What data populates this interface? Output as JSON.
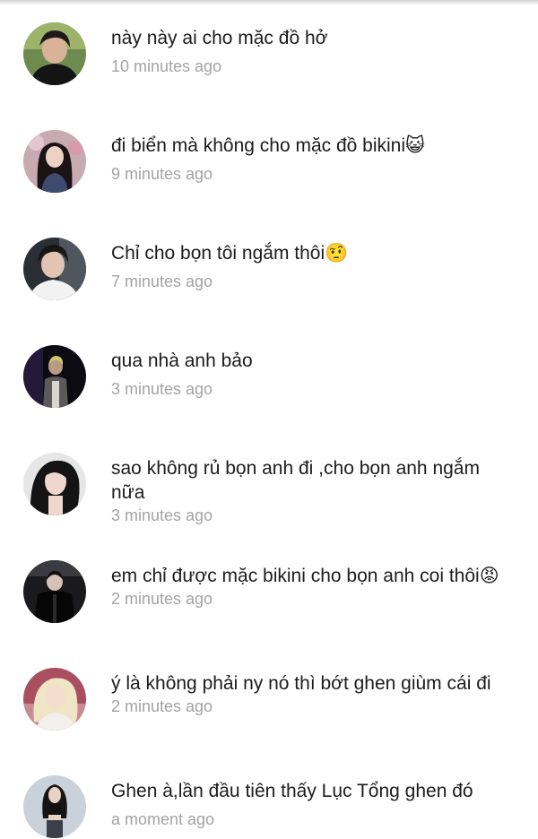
{
  "comments": [
    {
      "text": "này này ai cho mặc đồ hở",
      "time": "10 minutes ago",
      "avatar": "avatar-man-dark-hair"
    },
    {
      "text": "đi biển mà không cho mặc đồ bikini😺",
      "time": "9 minutes ago",
      "avatar": "avatar-woman-long-hair"
    },
    {
      "text": "Chỉ cho bọn tôi ngắm thôi🤨",
      "time": "7 minutes ago",
      "avatar": "avatar-man-white-shirt"
    },
    {
      "text": "qua nhà anh bảo",
      "time": "3 minutes ago",
      "avatar": "avatar-man-dark-stage"
    },
    {
      "text": "sao không rủ bọn anh đi ,cho bọn anh ngắm nữa",
      "time": "3 minutes ago",
      "avatar": "avatar-man-long-hair"
    },
    {
      "text": "em chỉ được mặc bikini cho bọn anh coi thôi😡",
      "time": "2 minutes ago",
      "avatar": "avatar-man-black-jacket"
    },
    {
      "text": "ý là không phải ny nó thì bớt ghen giùm cái đi",
      "time": "2 minutes ago",
      "avatar": "avatar-woman-blonde-pink"
    },
    {
      "text": "Ghen à,lần đầu tiên thấy Lục Tổng ghen đó",
      "time": "a moment ago",
      "avatar": "avatar-woman-black-outfit"
    }
  ]
}
